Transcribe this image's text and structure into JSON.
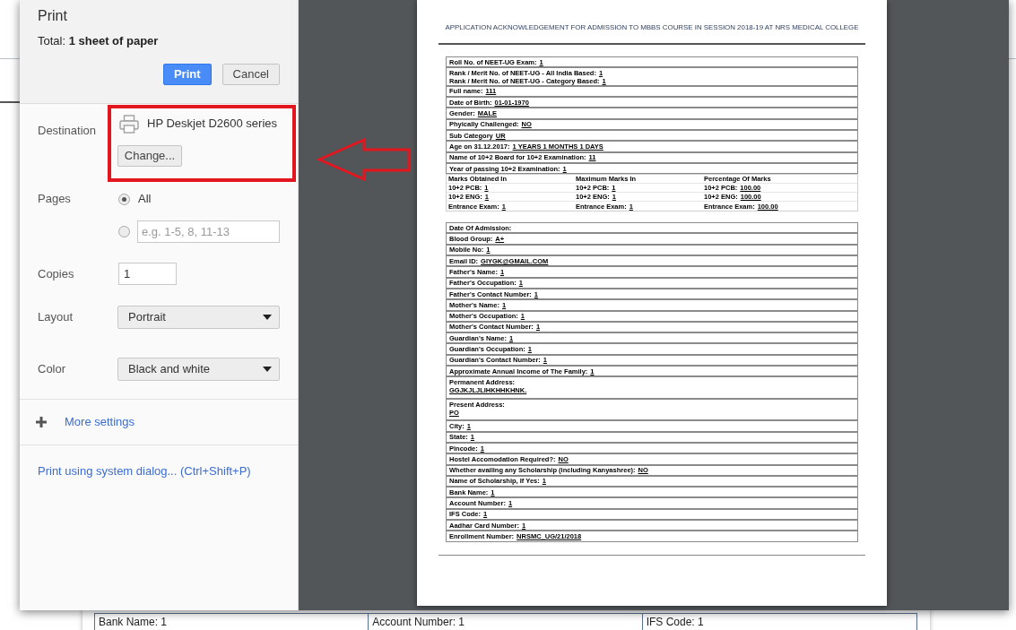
{
  "dialog": {
    "title": "Print",
    "summary": "Total: **1 sheet of paper**",
    "buttons": [
      {
        "label": "Print",
        "kind": "primary"
      },
      {
        "label": "Cancel",
        "kind": "secondary"
      }
    ]
  },
  "settings": {
    "destination": {
      "label": "Destination",
      "printer": "HP Deskjet D2600 series",
      "button": "Change..."
    },
    "pages": {
      "label": "Pages",
      "options": [
        {
          "kind": "all",
          "label": "All",
          "selected": true
        },
        {
          "kind": "range",
          "placeholder": "e.g. 1-5, 8, 11-13",
          "selected": false
        }
      ]
    },
    "copies": {
      "label": "Copies",
      "value": "1"
    },
    "layout": {
      "label": "Layout",
      "value": "Portrait"
    },
    "color": {
      "label": "Color",
      "value": "Black and white"
    },
    "more_settings": {
      "label": "More settings",
      "expanded": false
    },
    "system_dialog_link": "Print using system dialog... (Ctrl+Shift+P)"
  },
  "annotations": [
    {
      "kind": "highlight-rectangle"
    },
    {
      "kind": "arrow"
    }
  ],
  "preview": {
    "heading": "APPLICATION ACKNOWLEDGEMENT FOR ADMISSION TO MBBS COURSE IN SESSION 2018-19 AT NRS MEDICAL COLLEGE",
    "personal_details": [
      {
        "kind": "inline",
        "fields": [
          {
            "label": "Roll No. of NEET-UG Exam:",
            "value": "1"
          }
        ]
      },
      {
        "kind": "inline",
        "fields": [
          {
            "label": "Rank / Merit No. of NEET-UG - All India Based:",
            "value": "1"
          },
          {
            "label": "Rank / Merit No. of NEET-UG - Category Based:",
            "value": "1"
          }
        ]
      },
      {
        "kind": "inline",
        "fields": [
          {
            "label": "Full name:",
            "value": "111"
          }
        ]
      },
      {
        "kind": "inline",
        "fields": [
          {
            "label": "Date of Birth:",
            "value": "01-01-1970"
          }
        ]
      },
      {
        "kind": "inline",
        "fields": [
          {
            "label": "Gender:",
            "value": "MALE"
          }
        ]
      },
      {
        "kind": "inline",
        "fields": [
          {
            "label": "Phyically Challenged:",
            "value": "NO"
          }
        ]
      },
      {
        "kind": "inline",
        "fields": [
          {
            "label": "Sub Category",
            "value": "UR"
          }
        ]
      },
      {
        "kind": "inline",
        "fields": [
          {
            "label": "Age on 31.12.2017:",
            "value": "1 YEARS 1 MONTHS 1 DAYS"
          }
        ]
      },
      {
        "kind": "inline",
        "fields": [
          {
            "label": "Name of 10+2 Board for 10+2 Examination:",
            "value": "11"
          }
        ]
      },
      {
        "kind": "inline",
        "fields": [
          {
            "label": "Year of passing 10+2 Examination:",
            "value": "1"
          }
        ]
      }
    ],
    "marks": {
      "columns": [
        "Marks Obtained In",
        "Maximum Marks In",
        "Percentage Of Marks"
      ],
      "rows": [
        [
          {
            "label": "10+2 PCB:",
            "value": "1"
          },
          {
            "label": "10+2 PCB:",
            "value": "1"
          },
          {
            "label": "10+2 PCB:",
            "value": "100.00"
          }
        ],
        [
          {
            "label": "10+2 ENG:",
            "value": "1"
          },
          {
            "label": "10+2 ENG:",
            "value": "1"
          },
          {
            "label": "10+2 ENG:",
            "value": "100.00"
          }
        ],
        [
          {
            "label": "Entrance Exam:",
            "value": "1"
          },
          {
            "label": "Entrance Exam:",
            "value": "1"
          },
          {
            "label": "Entrance Exam:",
            "value": "100.00"
          }
        ]
      ]
    },
    "contact_details": [
      {
        "kind": "inline",
        "fields": [
          {
            "label": "Date Of Admission:"
          }
        ]
      },
      {
        "kind": "inline",
        "fields": [
          {
            "label": "Blood Group:",
            "value": "A+"
          }
        ]
      },
      {
        "kind": "inline",
        "fields": [
          {
            "label": "Mobile No:",
            "value": "1"
          }
        ]
      },
      {
        "kind": "inline",
        "fields": [
          {
            "label": "Email ID:",
            "value": "GIYGK@GMAIL.COM"
          }
        ]
      },
      {
        "kind": "inline",
        "fields": [
          {
            "label": "Father's Name:",
            "value": "1"
          }
        ]
      },
      {
        "kind": "inline",
        "fields": [
          {
            "label": "Father's Occupation:",
            "value": "1"
          }
        ]
      },
      {
        "kind": "inline",
        "fields": [
          {
            "label": "Father's Contact Number:",
            "value": "1"
          }
        ]
      },
      {
        "kind": "inline",
        "fields": [
          {
            "label": "Mother's Name:",
            "value": "1"
          }
        ]
      },
      {
        "kind": "inline",
        "fields": [
          {
            "label": "Mother's Occupation:",
            "value": "1"
          }
        ]
      },
      {
        "kind": "inline",
        "fields": [
          {
            "label": "Mother's Contact Number:",
            "value": "1"
          }
        ]
      },
      {
        "kind": "inline",
        "fields": [
          {
            "label": "Guardian's Name:",
            "value": "1"
          }
        ]
      },
      {
        "kind": "inline",
        "fields": [
          {
            "label": "Guardian's Occupation:",
            "value": "1"
          }
        ]
      },
      {
        "kind": "inline",
        "fields": [
          {
            "label": "Guardian's Contact Number:",
            "value": "1"
          }
        ]
      },
      {
        "kind": "inline",
        "fields": [
          {
            "label": "Approximate Annual Income of The Family:",
            "value": "1"
          }
        ]
      },
      {
        "kind": "stacked",
        "fields": [
          {
            "label": "Permanent Address:",
            "value": "GGJKJLJLIHKHHKHNK."
          }
        ]
      },
      {
        "kind": "stacked",
        "fields": [
          {
            "label": "Present Address:",
            "value": "PO"
          }
        ]
      },
      {
        "kind": "inline",
        "fields": [
          {
            "label": "City:",
            "value": "1"
          }
        ]
      },
      {
        "kind": "inline",
        "fields": [
          {
            "label": "State:",
            "value": "1"
          }
        ]
      },
      {
        "kind": "inline",
        "fields": [
          {
            "label": "Pincode:",
            "value": "1"
          }
        ]
      },
      {
        "kind": "inline",
        "fields": [
          {
            "label": "Hostel Accomodation Required?:",
            "value": "NO"
          }
        ]
      },
      {
        "kind": "inline",
        "fields": [
          {
            "label": "Whether availing any Scholarship (including Kanyashree):",
            "value": "NO"
          }
        ]
      },
      {
        "kind": "inline",
        "fields": [
          {
            "label": "Name of Scholarship, If Yes:",
            "value": "1"
          }
        ]
      },
      {
        "kind": "inline",
        "fields": [
          {
            "label": "Bank Name:",
            "value": "1"
          }
        ]
      },
      {
        "kind": "inline",
        "fields": [
          {
            "label": "Account Number:",
            "value": "1"
          }
        ]
      },
      {
        "kind": "inline",
        "fields": [
          {
            "label": "IFS Code:",
            "value": "1"
          }
        ]
      },
      {
        "kind": "inline",
        "fields": [
          {
            "label": "Aadhar Card Number:",
            "value": "1"
          }
        ]
      },
      {
        "kind": "inline",
        "fields": [
          {
            "label": "Enrollment Number:",
            "value": "NRSMC_UG/21/2018"
          }
        ]
      }
    ]
  },
  "background_page": {
    "table_cells": [
      "Bank Name: 1",
      "Account Number: 1",
      "IFS Code: 1"
    ]
  }
}
